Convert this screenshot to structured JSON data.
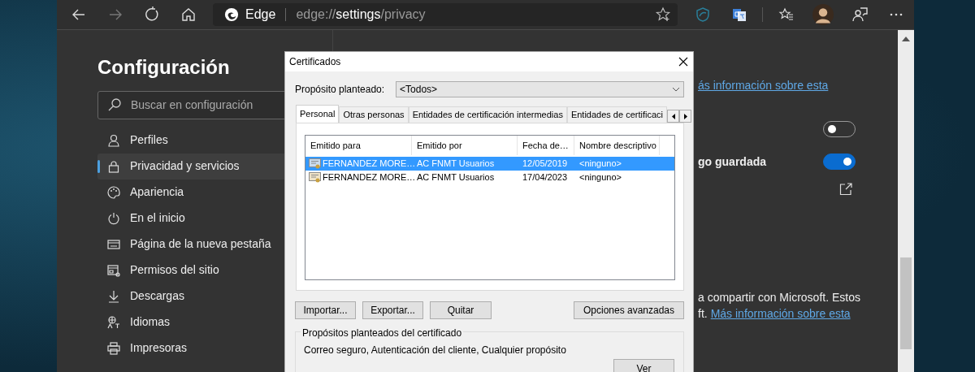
{
  "browser": {
    "nav": [
      {
        "kind": "back",
        "disabled": false
      },
      {
        "kind": "forward",
        "disabled": true
      },
      {
        "kind": "refresh",
        "disabled": false
      },
      {
        "kind": "home",
        "disabled": false
      }
    ],
    "site_label": "Edge",
    "url": {
      "scheme": "edge://",
      "host": "settings",
      "path": "/privacy"
    },
    "tools": [
      {
        "kind": "shield"
      },
      {
        "kind": "translate"
      },
      {
        "kind": "separator"
      },
      {
        "kind": "favorites"
      },
      {
        "kind": "avatar"
      },
      {
        "kind": "feedback"
      },
      {
        "kind": "more"
      }
    ]
  },
  "settings": {
    "title": "Configuración",
    "search": {
      "placeholder": "Buscar en configuración"
    },
    "nav": [
      {
        "label": "Perfiles",
        "kind": "person",
        "selected": false
      },
      {
        "label": "Privacidad y servicios",
        "kind": "lock",
        "selected": true
      },
      {
        "label": "Apariencia",
        "kind": "palette",
        "selected": false
      },
      {
        "label": "En el inicio",
        "kind": "power",
        "selected": false
      },
      {
        "label": "Página de la nueva pestaña",
        "kind": "newtab",
        "selected": false
      },
      {
        "label": "Permisos del sitio",
        "kind": "permissions",
        "selected": false
      },
      {
        "label": "Descargas",
        "kind": "download",
        "selected": false
      },
      {
        "label": "Idiomas",
        "kind": "languages",
        "selected": false
      },
      {
        "label": "Impresoras",
        "kind": "printer",
        "selected": false
      }
    ]
  },
  "content": {
    "link_1": "ás información sobre esta",
    "toggle_1": {
      "on": false
    },
    "setting_2": {
      "label": "go guardada",
      "on": true
    },
    "paragraph": {
      "line_1": "a compartir con Microsoft. Estos",
      "line_2": "ft.",
      "line_2_link": "Más información sobre esta"
    }
  },
  "dialog": {
    "title": "Certificados",
    "purpose_label": "Propósito planteado:",
    "purpose_value": "<Todos>",
    "tabs": [
      {
        "label": "Personal",
        "selected": true
      },
      {
        "label": "Otras personas",
        "selected": false
      },
      {
        "label": "Entidades de certificación intermedias",
        "selected": false
      },
      {
        "label": "Entidades de certificaci",
        "selected": false
      }
    ],
    "columns": [
      "Emitido para",
      "Emitido por",
      "Fecha de…",
      "Nombre descriptivo"
    ],
    "rows": [
      {
        "cells": [
          "FERNANDEZ MORE…",
          "AC FNMT Usuarios",
          "12/05/2019",
          "<ninguno>"
        ],
        "selected": true
      },
      {
        "cells": [
          "FERNANDEZ MORE…",
          "AC FNMT Usuarios",
          "17/04/2023",
          "<ninguno>"
        ],
        "selected": false
      }
    ],
    "buttons": [
      "Importar...",
      "Exportar...",
      "Quitar"
    ],
    "advanced_button": "Opciones avanzadas",
    "purposes": {
      "title": "Propósitos planteados del certificado",
      "text": "Correo seguro, Autenticación del cliente, Cualquier propósito",
      "button": "Ver"
    }
  }
}
